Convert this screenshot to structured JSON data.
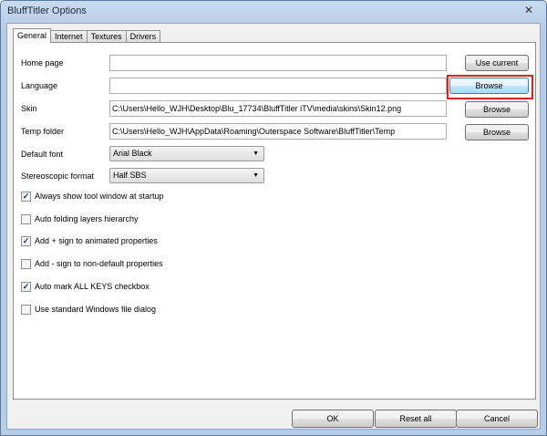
{
  "window": {
    "title": "BluffTitler Options",
    "close_glyph": "✕"
  },
  "tabs": [
    {
      "label": "General"
    },
    {
      "label": "Internet"
    },
    {
      "label": "Textures"
    },
    {
      "label": "Drivers"
    }
  ],
  "form": {
    "home_page": {
      "label": "Home page",
      "value": "",
      "button": "Use current"
    },
    "language": {
      "label": "Language",
      "value": "",
      "button": "Browse"
    },
    "skin": {
      "label": "Skin",
      "value": "C:\\Users\\Hello_WJH\\Desktop\\Blu_17734\\BluffTitler iTV\\media\\skins\\Skin12.png",
      "button": "Browse"
    },
    "temp_folder": {
      "label": "Temp folder",
      "value": "C:\\Users\\Hello_WJH\\AppData\\Roaming\\Outerspace Software\\BluffTitler\\Temp",
      "button": "Browse"
    },
    "default_font": {
      "label": "Default font",
      "value": "Arial Black"
    },
    "stereoscopic_format": {
      "label": "Stereoscopic format",
      "value": "Half SBS"
    }
  },
  "checkboxes": [
    {
      "label": "Always show tool window at startup",
      "checked": true
    },
    {
      "label": "Auto folding layers hierarchy",
      "checked": false
    },
    {
      "label": "Add + sign to animated properties",
      "checked": true
    },
    {
      "label": "Add - sign to non-default properties",
      "checked": false
    },
    {
      "label": "Auto mark ALL KEYS checkbox",
      "checked": true
    },
    {
      "label": "Use standard Windows file dialog",
      "checked": false
    }
  ],
  "buttons": {
    "ok": "OK",
    "reset_all": "Reset all",
    "cancel": "Cancel"
  },
  "colors": {
    "highlight": "#e0201c",
    "titlebar": "#b7cde6"
  }
}
